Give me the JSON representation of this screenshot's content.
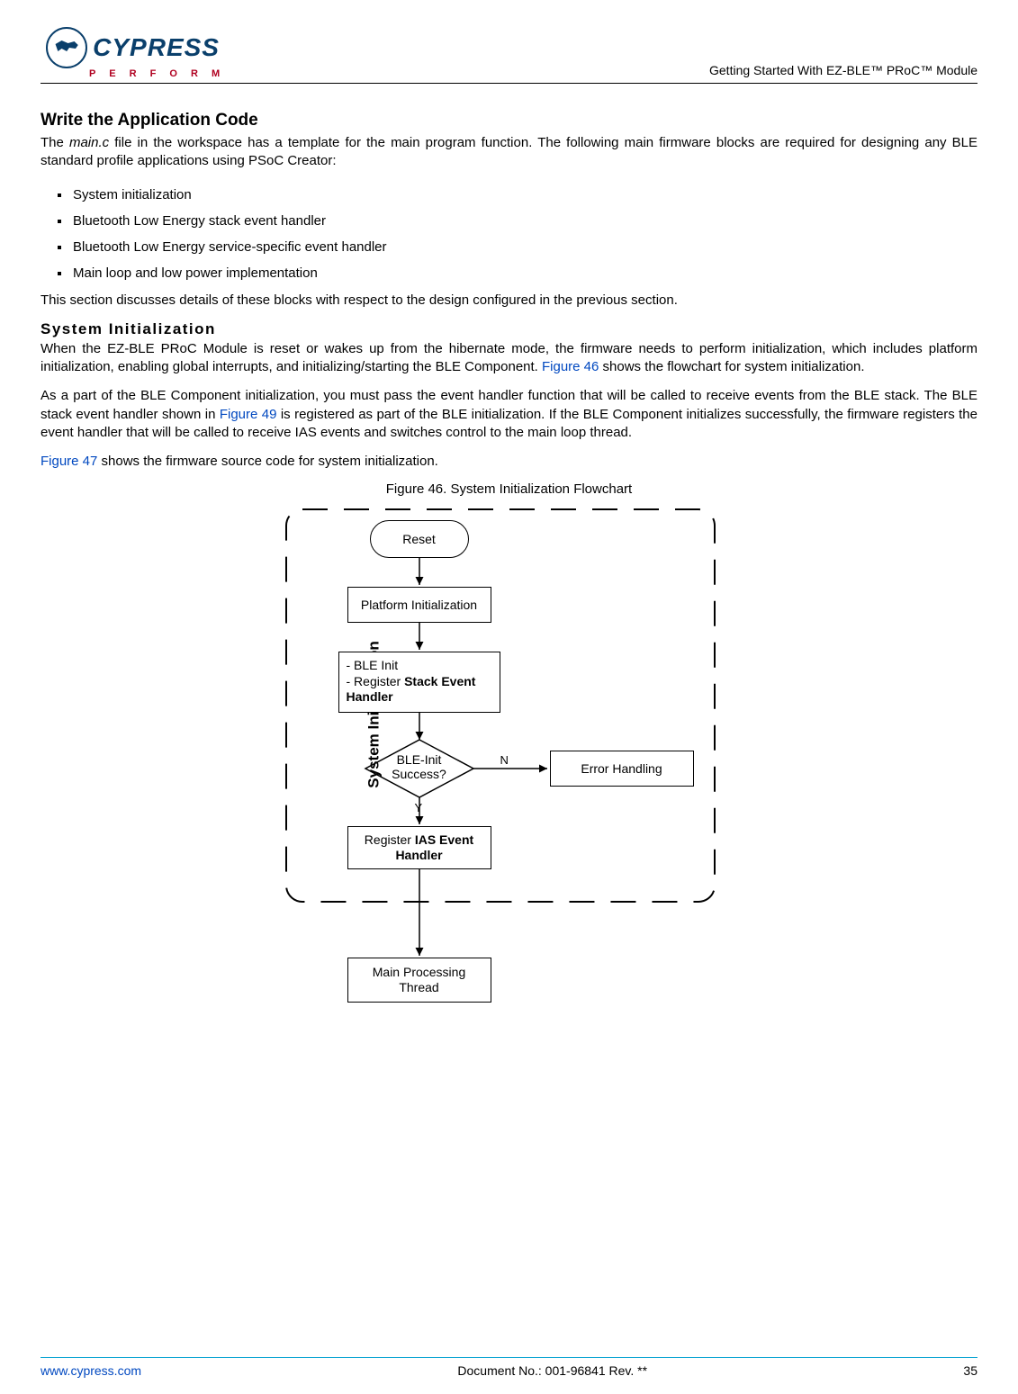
{
  "header": {
    "brand": "CYPRESS",
    "tagline": "P E R F O R M",
    "doc_title": "Getting Started With EZ-BLE™ PRoC™ Module"
  },
  "section": {
    "title": "Write the Application Code",
    "intro_a": "The ",
    "intro_file": "main.c",
    "intro_b": " file in the workspace has a template for the main program function. The following main firmware blocks are required for designing any BLE standard profile applications using PSoC Creator:",
    "bullets": [
      "System initialization",
      "Bluetooth Low Energy stack event handler",
      "Bluetooth Low Energy service-specific event handler",
      "Main loop and low power implementation"
    ],
    "after_list": "This section discusses details of these blocks with respect to the design  configured in the previous section."
  },
  "subsection": {
    "title": "System Initialization",
    "p1_a": "When the EZ-BLE PRoC Module is reset or wakes up from the hibernate mode, the firmware needs to perform initialization, which includes platform initialization, enabling global interrupts, and initializing/starting the BLE Component. ",
    "p1_ref": "Figure 46",
    "p1_b": " shows the flowchart for system initialization.",
    "p2_a": "As a part of the BLE Component initialization, you must pass the event handler function that will be called to receive events from the BLE stack. The BLE stack event handler shown in ",
    "p2_ref": "Figure 49",
    "p2_b": " is registered as part of the BLE initialization. If the BLE Component initializes successfully, the firmware registers the event handler that will be called to receive IAS events and switches control to the main loop thread.",
    "p3_ref": "Figure 47",
    "p3_b": " shows the firmware source code for system initialization."
  },
  "figure": {
    "caption": "Figure 46. System Initialization Flowchart",
    "group_label": "System Initialization",
    "reset": "Reset",
    "platform": "Platform Initialization",
    "ble_init_line1": "- BLE Init",
    "ble_init_line2_a": "- Register ",
    "ble_init_line2_b": "Stack Event Handler",
    "decision": "BLE-Init Success?",
    "yes": "Y",
    "no": "N",
    "error": "Error Handling",
    "register_a": "Register ",
    "register_b": "IAS Event Handler",
    "main_thread": "Main Processing Thread"
  },
  "footer": {
    "url": "www.cypress.com",
    "docno": "Document No.: 001-96841 Rev. **",
    "page": "35"
  }
}
